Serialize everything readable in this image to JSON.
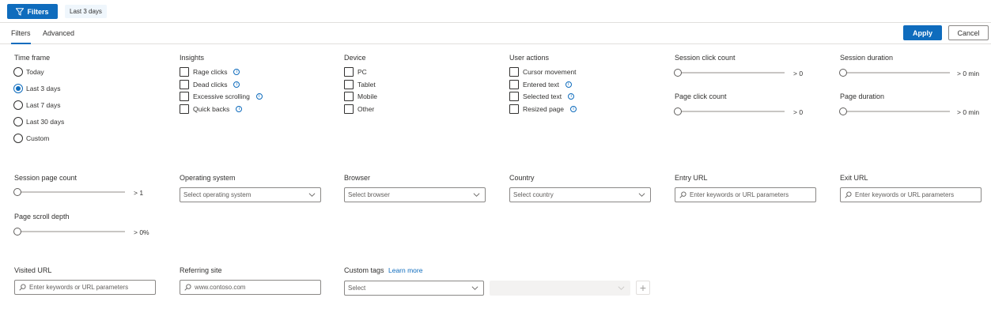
{
  "topbar": {
    "filters_label": "Filters",
    "active_chip": "Last 3 days"
  },
  "tabs": [
    {
      "label": "Filters"
    },
    {
      "label": "Advanced"
    }
  ],
  "actions": {
    "apply": "Apply",
    "cancel": "Cancel"
  },
  "time_frame": {
    "title": "Time frame",
    "options": [
      "Today",
      "Last 3 days",
      "Last 7 days",
      "Last 30 days",
      "Custom"
    ],
    "selected": "Last 3 days"
  },
  "insights": {
    "title": "Insights",
    "options": [
      "Rage clicks",
      "Dead clicks",
      "Excessive scrolling",
      "Quick backs"
    ]
  },
  "device": {
    "title": "Device",
    "options": [
      "PC",
      "Tablet",
      "Mobile",
      "Other"
    ]
  },
  "user_actions": {
    "title": "User actions",
    "options": [
      "Cursor movement",
      "Entered text",
      "Selected text",
      "Resized page"
    ]
  },
  "sliders": {
    "session_click_count": {
      "label": "Session click count",
      "value": "> 0"
    },
    "session_duration": {
      "label": "Session duration",
      "value": "> 0 min"
    },
    "page_click_count": {
      "label": "Page click count",
      "value": "> 0"
    },
    "page_duration": {
      "label": "Page duration",
      "value": "> 0 min"
    },
    "session_page_count": {
      "label": "Session page count",
      "value": "> 1"
    },
    "page_scroll_depth": {
      "label": "Page scroll depth",
      "value": "> 0%"
    }
  },
  "operating_system": {
    "label": "Operating system",
    "placeholder": "Select operating system"
  },
  "browser": {
    "label": "Browser",
    "placeholder": "Select browser"
  },
  "country": {
    "label": "Country",
    "placeholder": "Select country"
  },
  "entry_url": {
    "label": "Entry URL",
    "placeholder": "Enter keywords or URL parameters"
  },
  "exit_url": {
    "label": "Exit URL",
    "placeholder": "Enter keywords or URL parameters"
  },
  "visited_url": {
    "label": "Visited URL",
    "placeholder": "Enter keywords or URL parameters"
  },
  "referring_site": {
    "label": "Referring site",
    "placeholder": "www.contoso.com"
  },
  "custom_tags": {
    "label": "Custom tags",
    "learn_more": "Learn more",
    "select_placeholder": "Select",
    "add_symbol": "+"
  },
  "colors": {
    "accent": "#0f6cbd",
    "border": "#8a8886",
    "text": "#323130"
  }
}
